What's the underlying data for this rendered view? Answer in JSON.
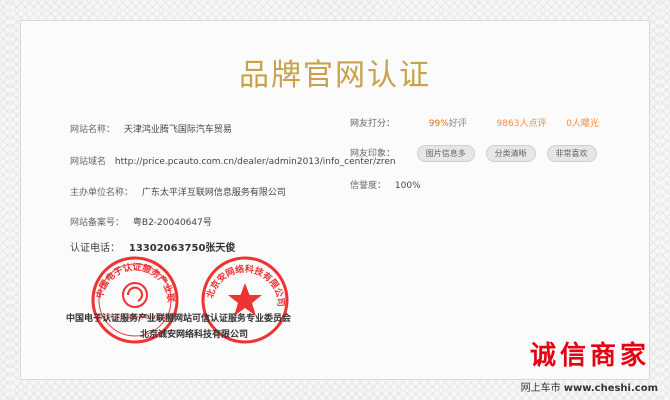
{
  "title": "品牌官网认证",
  "left": {
    "site_name": {
      "label": "网站名称：",
      "value": "天津鸿业腾飞国际汽车贸易"
    },
    "site_domain": {
      "label": "网站域名",
      "value": "http://price.pcauto.com.cn/dealer/admin2013/info_center/zren"
    },
    "host_org": {
      "label": "主办单位名称：",
      "value": "广东太平洋互联网信息服务有限公司"
    },
    "icp": {
      "label": "网站备案号：",
      "value": "粤B2-20040647号"
    },
    "phone": {
      "label": "认证电话：",
      "value": "13302063750张天俊"
    }
  },
  "right": {
    "score": {
      "label": "网友打分：",
      "pct": "99%",
      "pct_suffix": "好评",
      "review_count": "9863人点评",
      "exposure": "0人曝光"
    },
    "impressions": {
      "label": "网友印象：",
      "tags": [
        "图片信息多",
        "分类清晰",
        "非常喜欢"
      ]
    },
    "credit": {
      "label": "信誉度：",
      "value": "100%"
    }
  },
  "stamps": {
    "left_stamp": "中国电子认证服务产业联盟",
    "left_stamp_inner": "网站可信认证服务专业委员会",
    "right_stamp": "北京安网络科技有限公司"
  },
  "footer_org_line1": "中国电子认证服务产业联盟网站可信认证服务专业委员会",
  "footer_org_line2": "北京诚安网络科技有限公司",
  "brand": {
    "name": "诚信商家",
    "site": "网上车市",
    "url": "www.cheshi.com"
  },
  "colors": {
    "title": "#c8a24a",
    "stamp": "#e33333",
    "brand": "#e60012",
    "accent": "#ff6a00"
  }
}
